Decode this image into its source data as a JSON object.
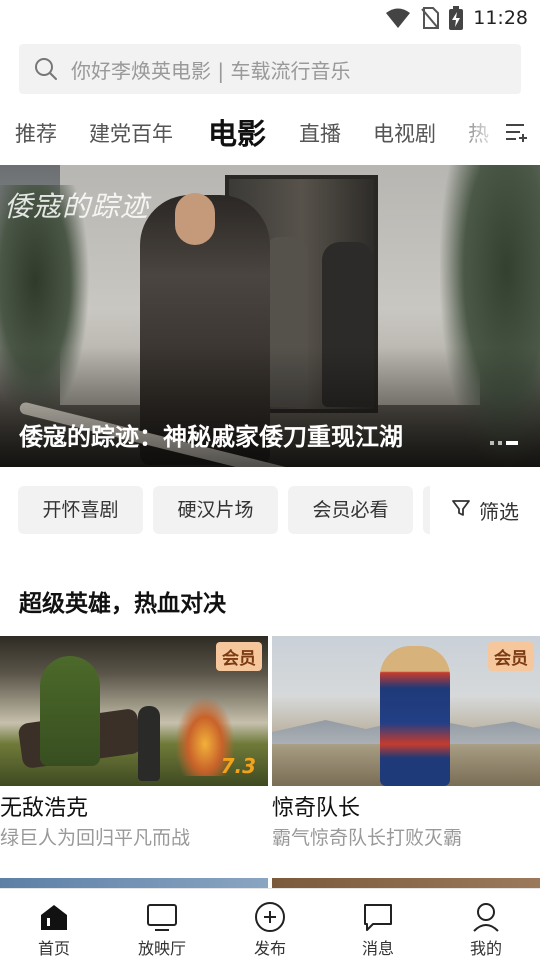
{
  "status_bar": {
    "time": "11:28",
    "icons": [
      "wifi-icon",
      "no-sim-icon",
      "battery-charging-icon"
    ]
  },
  "search": {
    "placeholder": "你好李焕英电影 | 车载流行音乐",
    "icon": "search-icon"
  },
  "tabs": {
    "items": [
      {
        "label": "推荐",
        "active": false
      },
      {
        "label": "建党百年",
        "active": false
      },
      {
        "label": "电影",
        "active": true
      },
      {
        "label": "直播",
        "active": false
      },
      {
        "label": "电视剧",
        "active": false
      },
      {
        "label": "热",
        "active": false
      }
    ],
    "menu_icon": "channel-menu-icon"
  },
  "banner": {
    "title_art": "倭寇的踪迹",
    "caption": "倭寇的踪迹：神秘戚家倭刀重现江湖",
    "slide_count": 3,
    "active_slide": 3
  },
  "filter_chips": {
    "items": [
      "开怀喜剧",
      "硬汉片场",
      "会员必看"
    ],
    "filter_label": "筛选",
    "filter_icon": "funnel-icon"
  },
  "section": {
    "title": "超级英雄，热血对决"
  },
  "cards": [
    {
      "title": "无敌浩克",
      "subtitle": "绿巨人为回归平凡而战",
      "badge": "会员",
      "score": "7.3"
    },
    {
      "title": "惊奇队长",
      "subtitle": "霸气惊奇队长打败灭霸",
      "badge": "会员"
    }
  ],
  "bottom_nav": {
    "items": [
      {
        "label": "首页",
        "icon": "home-icon",
        "active": true
      },
      {
        "label": "放映厅",
        "icon": "tv-icon",
        "active": false
      },
      {
        "label": "发布",
        "icon": "plus-circle-icon",
        "active": false
      },
      {
        "label": "消息",
        "icon": "message-icon",
        "active": false
      },
      {
        "label": "我的",
        "icon": "profile-icon",
        "active": false
      }
    ]
  },
  "colors": {
    "badge_bg": "#f6c79d",
    "badge_text": "#7a3a12",
    "score": "#f2a21b",
    "search_bg": "#f2f2f2"
  }
}
